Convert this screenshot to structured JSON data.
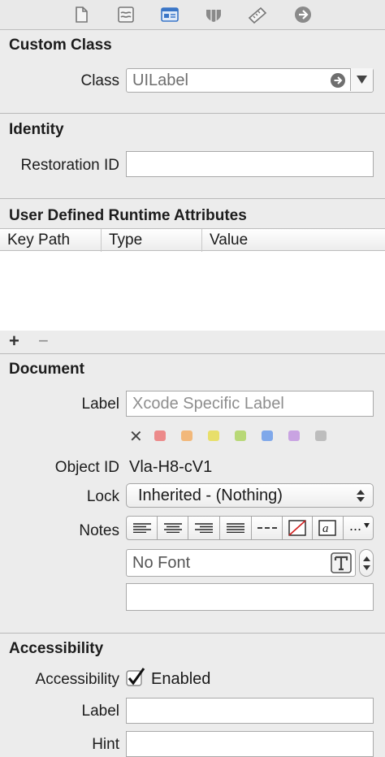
{
  "toolbar": {
    "icons": [
      "file-inspector-icon",
      "quick-help-icon",
      "identity-inspector-icon",
      "attributes-inspector-icon",
      "size-inspector-icon",
      "connections-inspector-icon"
    ]
  },
  "custom_class": {
    "title": "Custom Class",
    "class_label": "Class",
    "class_value": "UILabel"
  },
  "identity": {
    "title": "Identity",
    "restoration_id_label": "Restoration ID",
    "restoration_id_value": ""
  },
  "runtime_attributes": {
    "title": "User Defined Runtime Attributes",
    "columns": [
      "Key Path",
      "Type",
      "Value"
    ],
    "add_label": "+",
    "remove_label": "−"
  },
  "document": {
    "title": "Document",
    "label_label": "Label",
    "label_placeholder": "Xcode Specific Label",
    "clear_color_label": "✕",
    "colors": [
      "#ec8a8a",
      "#f2b87a",
      "#e8df6a",
      "#b8d877",
      "#7fa8ea",
      "#c9a3e2",
      "#bdbdbd"
    ],
    "object_id_label": "Object ID",
    "object_id_value": "Vla-H8-cV1",
    "lock_label": "Lock",
    "lock_value": "Inherited - (Nothing)",
    "notes_label": "Notes",
    "font_value": "No Font",
    "more_label": "..."
  },
  "accessibility": {
    "title": "Accessibility",
    "accessibility_label": "Accessibility",
    "enabled_label": "Enabled",
    "enabled": true,
    "label_label": "Label",
    "hint_label": "Hint"
  }
}
